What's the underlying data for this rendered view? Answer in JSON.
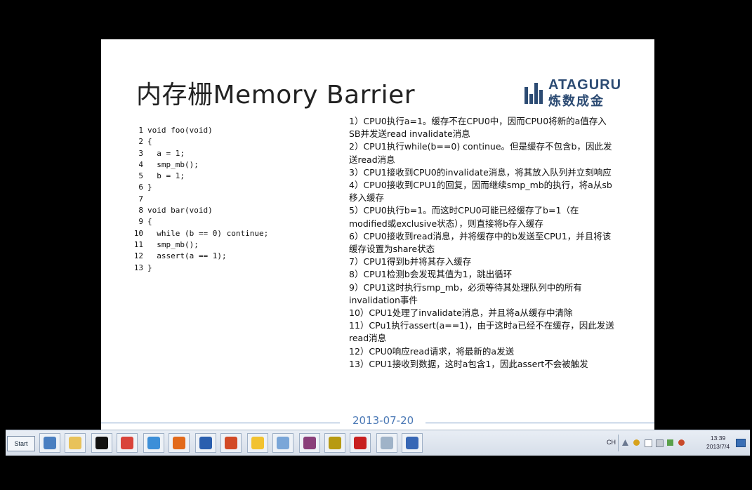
{
  "slide": {
    "title": "内存栅Memory Barrier",
    "logo_brand": "ATAGURU",
    "logo_tagline": "炼数成金",
    "date": "2013-07-20",
    "code_lines": [
      {
        "n": "1",
        "t": "void foo(void)"
      },
      {
        "n": "2",
        "t": "{"
      },
      {
        "n": "3",
        "t": "  a = 1;"
      },
      {
        "n": "4",
        "t": "  smp_mb();"
      },
      {
        "n": "5",
        "t": "  b = 1;"
      },
      {
        "n": "6",
        "t": "}"
      },
      {
        "n": "7",
        "t": ""
      },
      {
        "n": "8",
        "t": "void bar(void)"
      },
      {
        "n": "9",
        "t": "{"
      },
      {
        "n": "10",
        "t": "  while (b == 0) continue;"
      },
      {
        "n": "11",
        "t": "  smp_mb();"
      },
      {
        "n": "12",
        "t": "  assert(a == 1);"
      },
      {
        "n": "13",
        "t": "}"
      }
    ],
    "steps": [
      "1）CPU0执行a=1。缓存不在CPU0中，因而CPU0将新的a值存入SB并发送read invalidate消息",
      "2）CPU1执行while(b==0) continue。但是缓存不包含b，因此发送read消息",
      "3）CPU1接收到CPU0的invalidate消息，将其放入队列并立刻响应",
      "4）CPU0接收到CPU1的回复，因而继续smp_mb的执行，将a从sb移入缓存",
      "5）CPU0执行b=1。而这时CPU0可能已经缓存了b=1（在modified或exclusive状态），则直接将b存入缓存",
      "6）CPU0接收到read消息，并将缓存中的b发送至CPU1，并且将该缓存设置为share状态",
      "7）CPU1得到b并将其存入缓存",
      "8）CPU1检测b会发现其值为1，跳出循环",
      "9）CPU1这时执行smp_mb，必须等待其处理队列中的所有invalidation事件",
      "10）CPU1处理了invalidate消息，并且将a从缓存中清除",
      "11）CPu1执行assert(a==1)，由于这时a已经不在缓存，因此发送read消息",
      "12）CPU0响应read请求，将最新的a发送",
      "13）CPU1接收到数据，这时a包含1，因此assert不会被触发"
    ]
  },
  "taskbar": {
    "start_label": "Start",
    "apps": [
      {
        "name": "network-icon",
        "color": "#4a7fc1"
      },
      {
        "name": "file-explorer-icon",
        "color": "#e8c25a"
      },
      {
        "name": "command-prompt-icon",
        "color": "#111111"
      },
      {
        "name": "chrome-icon",
        "color": "#d9433a"
      },
      {
        "name": "app-icon",
        "color": "#3d8fd8"
      },
      {
        "name": "firefox-icon",
        "color": "#e26a1b"
      },
      {
        "name": "word-icon",
        "color": "#2b5fae"
      },
      {
        "name": "powerpoint-icon",
        "color": "#d24a26"
      },
      {
        "name": "sticky-notes-icon",
        "color": "#f2c230"
      },
      {
        "name": "paint-icon",
        "color": "#7aa6d8"
      },
      {
        "name": "winrar-icon",
        "color": "#8a3f7a"
      },
      {
        "name": "ultraedit-icon",
        "color": "#b79a12"
      },
      {
        "name": "acrobat-icon",
        "color": "#c81f1f"
      },
      {
        "name": "calculator-icon",
        "color": "#9fb3c8"
      },
      {
        "name": "remote-desktop-icon",
        "color": "#3767b5"
      }
    ],
    "tray": {
      "language": "CH",
      "time": "13:39",
      "date": "2013/7/4"
    }
  }
}
